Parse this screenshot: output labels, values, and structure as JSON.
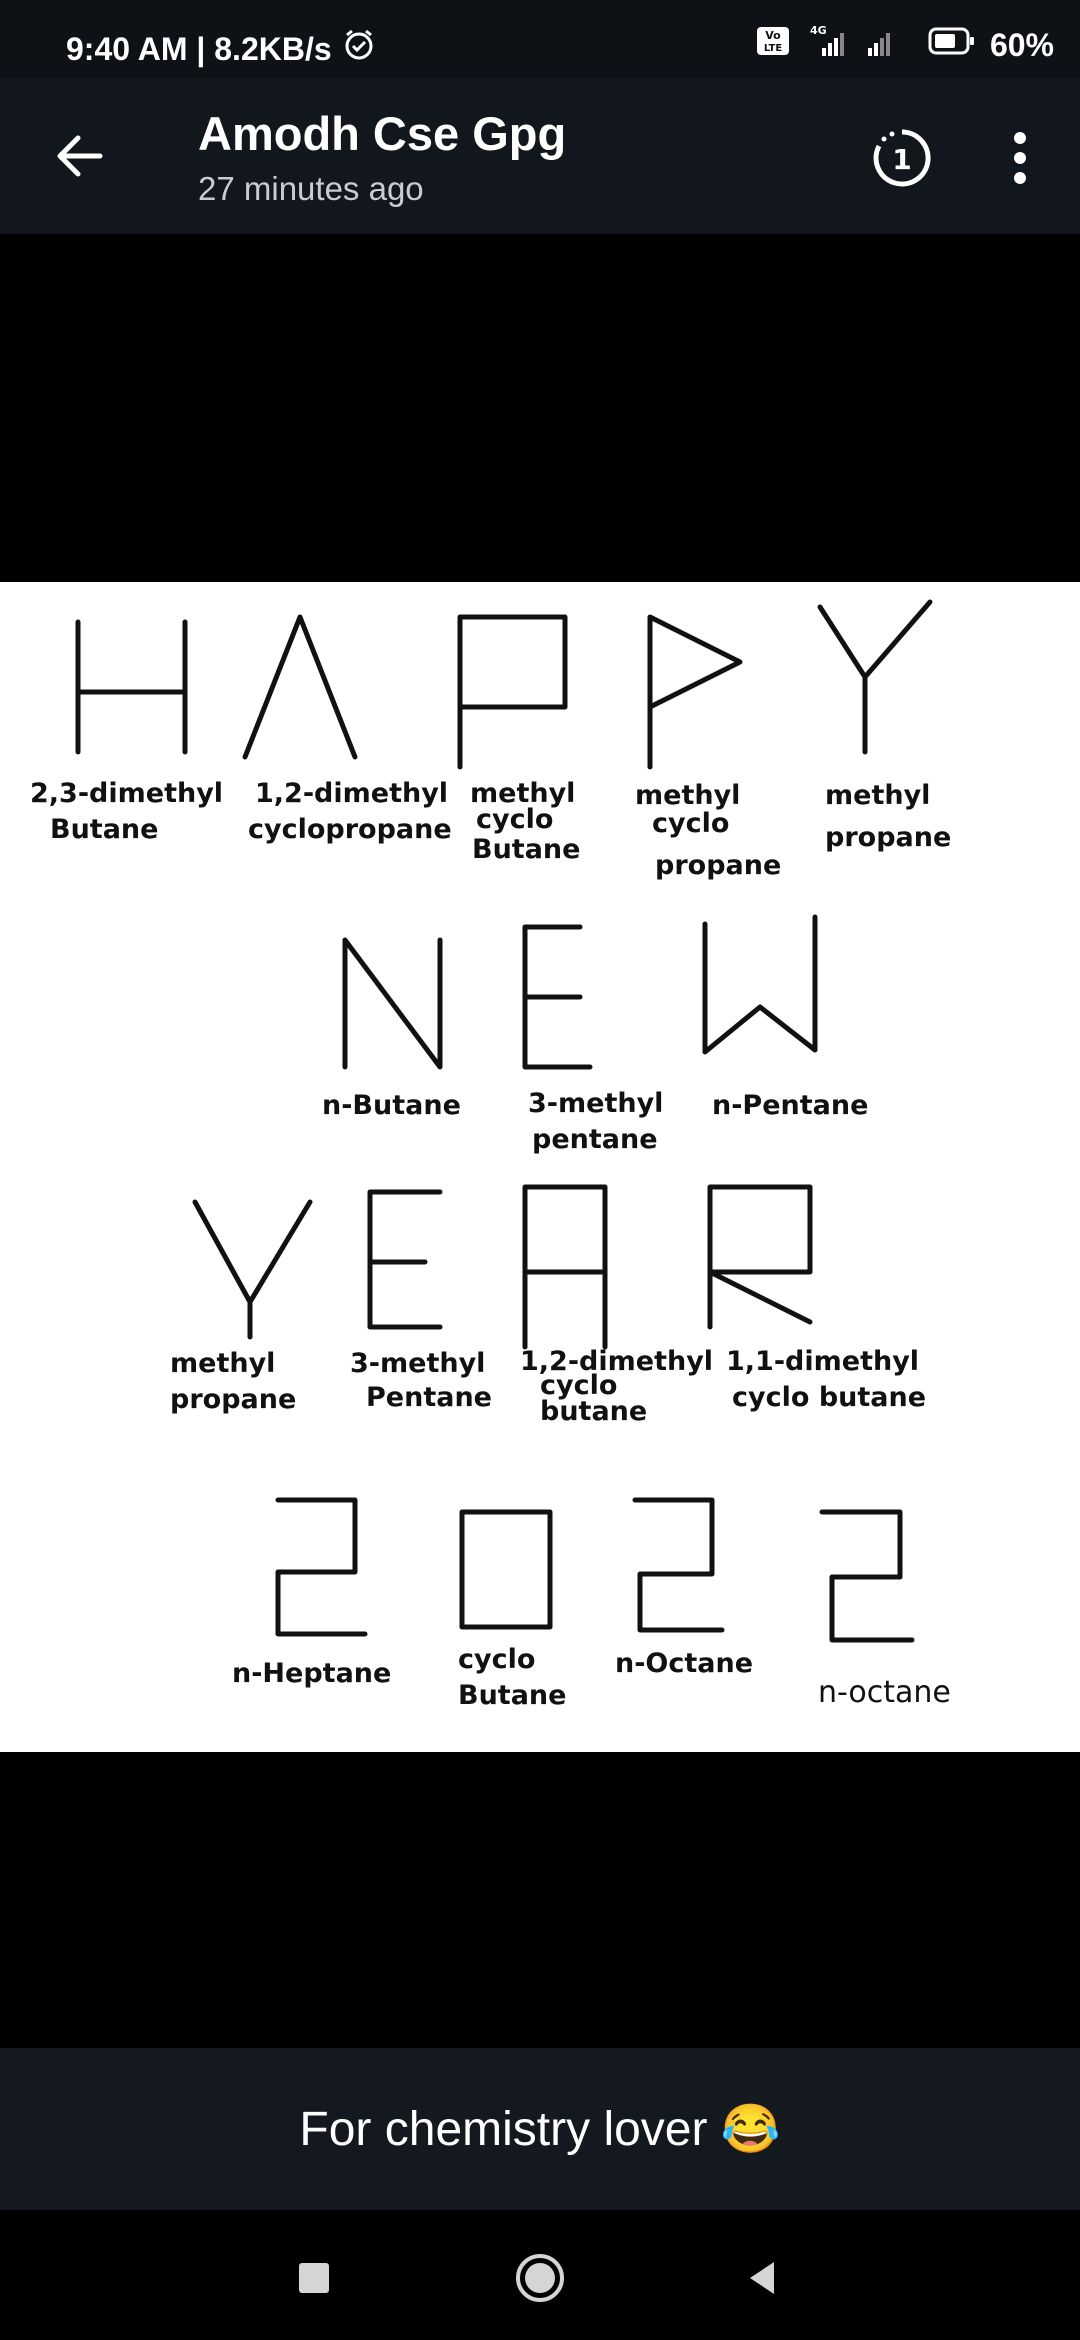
{
  "status_bar": {
    "time_speed": "9:40 AM | 8.2KB/s",
    "network_badge": "Vo LTE",
    "network_type": "4G",
    "battery": "60%",
    "icons": [
      "alarm-icon",
      "volte-icon",
      "signal-icon",
      "battery-icon"
    ]
  },
  "header": {
    "title": "Amodh Cse Gpg",
    "subtitle": "27 minutes ago",
    "timer_label": "1",
    "icons": [
      "back-arrow-icon",
      "view-once-timer-icon",
      "more-vert-icon"
    ]
  },
  "image": {
    "letters": [
      "H",
      "A",
      "P",
      "P",
      "Y",
      "N",
      "E",
      "W",
      "Y",
      "E",
      "A",
      "R",
      "2",
      "0",
      "2",
      "2"
    ],
    "labels": {
      "h": [
        "2,3-dimethyl",
        "Butane"
      ],
      "a": [
        "1,2-dimethyl",
        "cyclopropane"
      ],
      "p1": [
        "methyl",
        "cyclo",
        "Butane"
      ],
      "p2": [
        "methyl",
        "cyclo",
        "propane"
      ],
      "y1": [
        "methyl",
        "propane"
      ],
      "n": [
        "n-Butane"
      ],
      "e1": [
        "3-methyl",
        "pentane"
      ],
      "w": [
        "n-Pentane"
      ],
      "y2": [
        "methyl",
        "propane"
      ],
      "e2": [
        "3-methyl",
        "Pentane"
      ],
      "a2": [
        "1,2-dimethyl",
        "cyclo",
        "butane"
      ],
      "r": [
        "1,1-dimethyl",
        "cyclo butane"
      ],
      "two1": [
        "n-Heptane"
      ],
      "zero": [
        "cyclo",
        "Butane"
      ],
      "two2": [
        "n-Octane"
      ],
      "two3": [
        "n-octane"
      ]
    }
  },
  "caption": {
    "text": "For chemistry lover 😂"
  },
  "nav": {
    "icons": [
      "recent-apps-icon",
      "home-icon",
      "back-icon"
    ]
  }
}
